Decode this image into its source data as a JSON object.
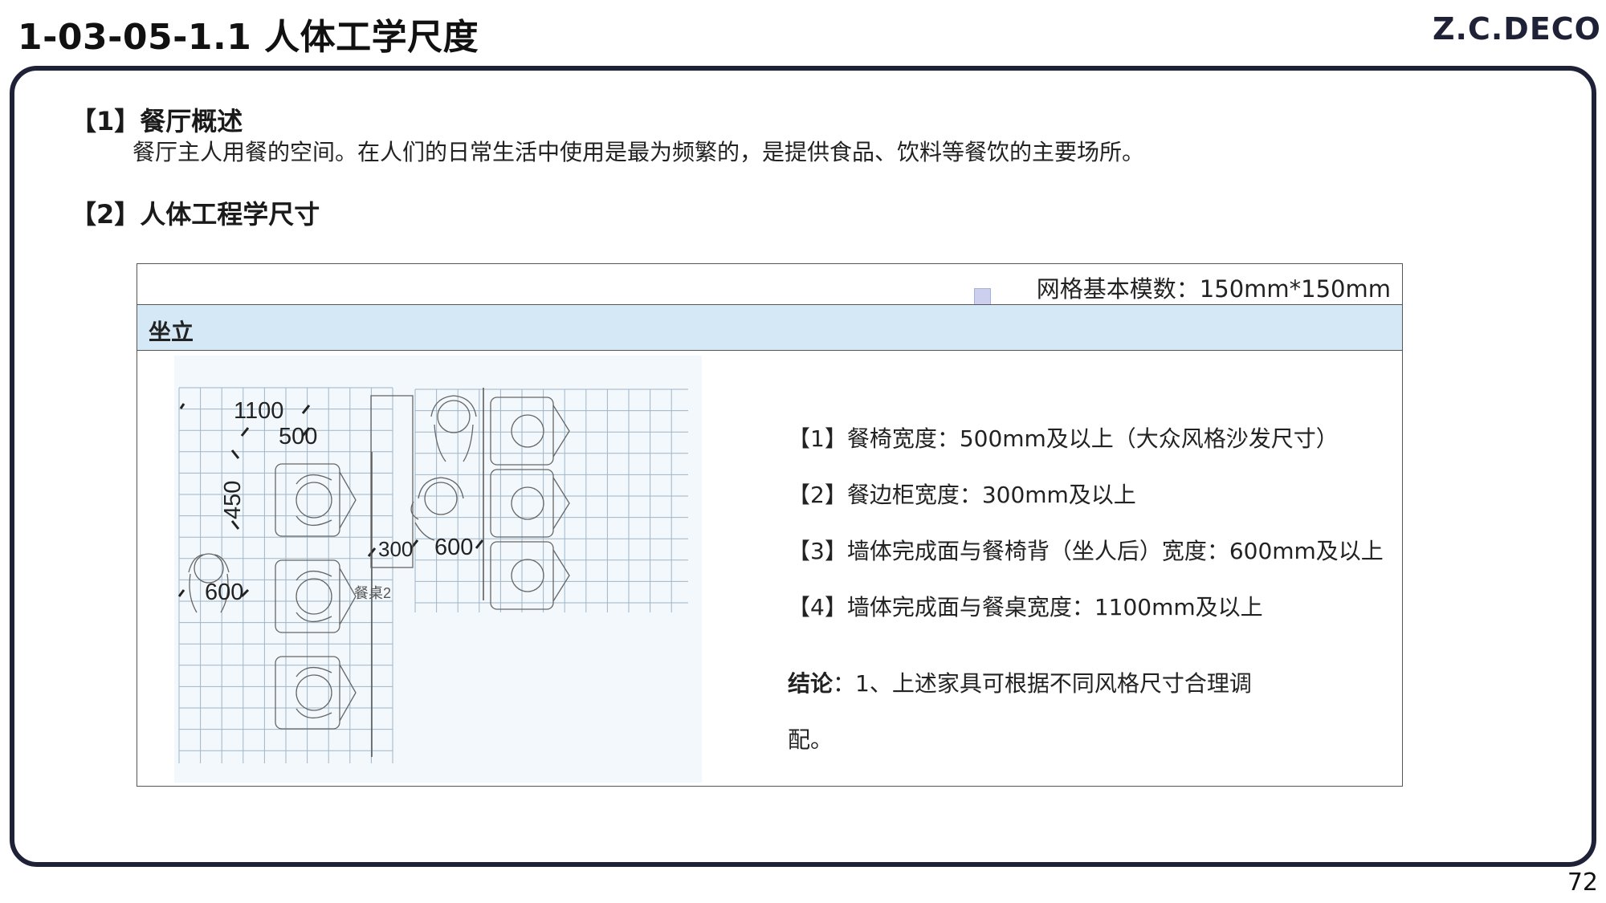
{
  "header": {
    "title": "1-03-05-1.1 人体工学尺度",
    "brand": "Z.C.DECO"
  },
  "section1": {
    "heading": "【1】餐厅概述",
    "body": "餐厅主人用餐的空间。在人们的日常生活中使用是最为频繁的，是提供食品、饮料等餐饮的主要场所。"
  },
  "section2": {
    "heading": "【2】人体工程学尺寸"
  },
  "panel": {
    "grid_note": "网格基本模数：150mm*150mm",
    "band_label": "坐立",
    "diagram": {
      "dim_1100": "1100",
      "dim_500": "500",
      "dim_450": "450",
      "dim_600_left": "600",
      "dim_300": "300",
      "dim_600_right": "600",
      "table_label": "餐桌2"
    },
    "points": [
      "【1】餐椅宽度：500mm及以上（大众风格沙发尺寸）",
      "【2】餐边柜宽度：300mm及以上",
      "【3】墙体完成面与餐椅背（坐人后）宽度：600mm及以上",
      "【4】墙体完成面与餐桌宽度：1100mm及以上"
    ],
    "conclusion_label": "结论",
    "conclusion_text": "：1、上述家具可根据不同风格尺寸合理调配。"
  },
  "footer": {
    "page_number": "72"
  },
  "colors": {
    "frame": "#1f2237",
    "band": "#d4e8f6",
    "diagram_bg": "#f2f8fb",
    "grid": "#9fb5c8"
  }
}
